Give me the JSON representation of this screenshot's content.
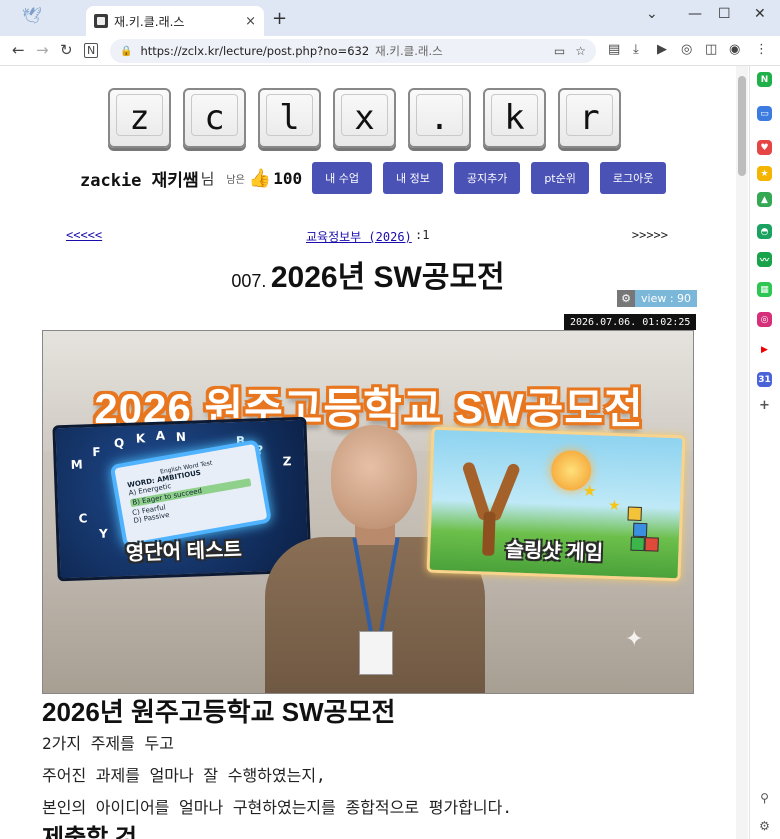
{
  "browser": {
    "tab_title": "재.키.클.래.스",
    "tab_close": "×",
    "new_tab": "+",
    "url": "https://zclx.kr/lecture/post.php?no=632",
    "url_site_label": "재.키.클.래.스"
  },
  "logo_keys": [
    "z",
    "c",
    "l",
    "x",
    ".",
    "k",
    "r"
  ],
  "user": {
    "name": "zackie 재키쌤",
    "suffix": "님",
    "remain_label": "남은",
    "points": "100"
  },
  "nav_buttons": [
    "내 수업",
    "내 정보",
    "공지추가",
    "pt순위",
    "로그아웃"
  ],
  "pager": {
    "prev": "<<<<<",
    "next": ">>>>>",
    "category": "교육정보부 (2026)",
    "category_suffix": ":1"
  },
  "post": {
    "number": "007.",
    "title": "2026년 SW공모전",
    "views": "view : 90",
    "date": "2026.07.06. 01:02:25"
  },
  "hero": {
    "headline": "2026 원주고등학교 SW공모전",
    "left_caption": "영단어 테스트",
    "right_caption": "슬링샷 게임",
    "tablet_lines": [
      "English Word Test",
      "WORD: AMBITIOUS",
      "A) Energetic",
      "B) Eager to succeed",
      "C) Fearful",
      "D) Passive"
    ],
    "letters": [
      "M",
      "F",
      "Q",
      "K",
      "A",
      "N",
      "B",
      "Z",
      "C",
      "Y",
      "?"
    ]
  },
  "article": {
    "heading": "2026년 원주고등학교 SW공모전",
    "lines": [
      "2가지 주제를 두고",
      "주어진 과제를 얼마나 잘 수행하였는지,",
      "본인의 아이디어를 얼마나 구현하였는지를 종합적으로 평가합니다."
    ],
    "subheading": "제출할 것"
  },
  "colors": {
    "button_bg": "#4a52b5",
    "view_badge": "#7bb7d8",
    "hero_title_stroke": "#e8761e"
  }
}
